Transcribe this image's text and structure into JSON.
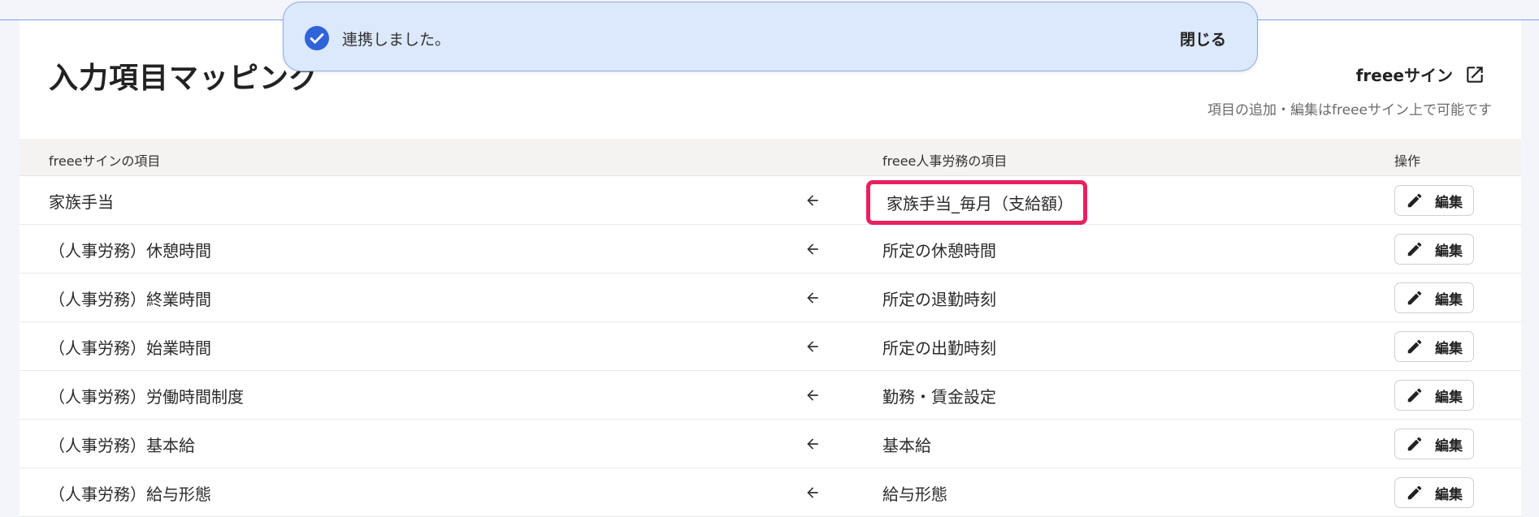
{
  "header": {
    "title": "入力項目マッピング",
    "sign_link_label": "freeeサイン",
    "hint": "項目の追加・編集はfreeeサイン上で可能です"
  },
  "toast": {
    "message": "連携しました。",
    "close_label": "閉じる"
  },
  "table": {
    "headers": {
      "left": "freeeサインの項目",
      "right": "freee人事労務の項目",
      "action": "操作"
    },
    "rows": [
      {
        "left": "家族手当",
        "right": "家族手当_毎月（支給額）",
        "highlighted": true,
        "action": "編集"
      },
      {
        "left": "（人事労務）休憩時間",
        "right": "所定の休憩時間",
        "action": "編集"
      },
      {
        "left": "（人事労務）終業時間",
        "right": "所定の退勤時刻",
        "action": "編集"
      },
      {
        "left": "（人事労務）始業時間",
        "right": "所定の出勤時刻",
        "action": "編集"
      },
      {
        "left": "（人事労務）労働時間制度",
        "right": "勤務・賃金設定",
        "action": "編集"
      },
      {
        "left": "（人事労務）基本給",
        "right": "基本給",
        "action": "編集"
      },
      {
        "left": "（人事労務）給与形態",
        "right": "給与形態",
        "action": "編集"
      }
    ]
  },
  "colors": {
    "accent": "#2f63d8",
    "highlight_border": "#e8205e",
    "toast_bg": "#dce8fb"
  },
  "icons": {
    "toast": "check-circle-icon",
    "sign_link": "external-link-icon",
    "row_arrow": "arrow-left-icon",
    "edit": "pencil-icon"
  }
}
